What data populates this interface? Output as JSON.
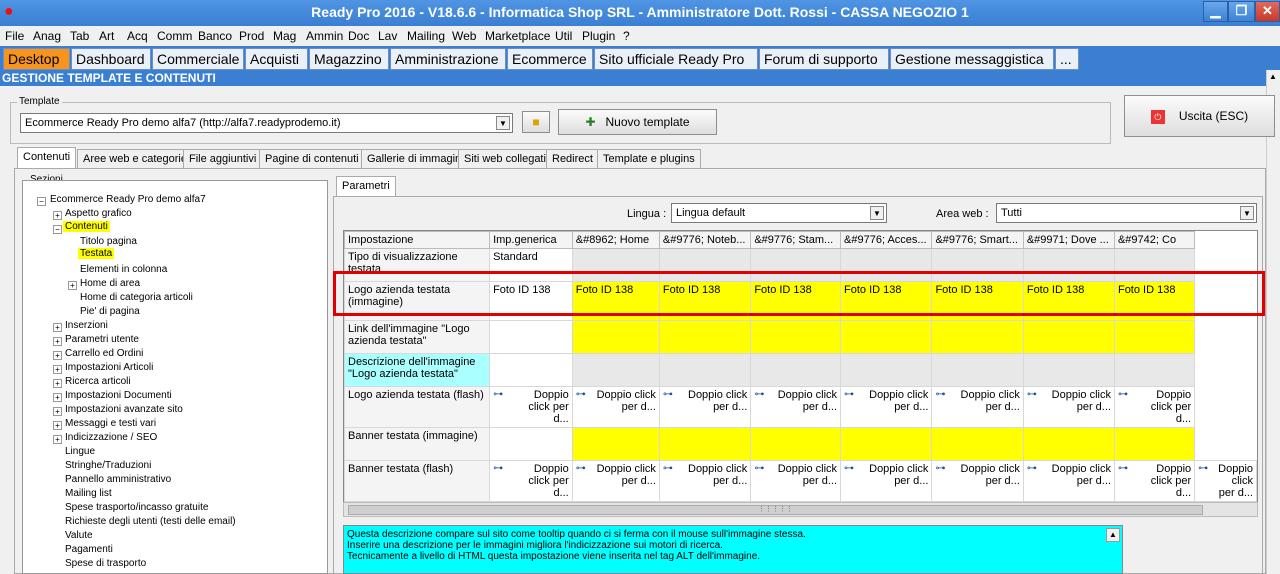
{
  "window": {
    "title": "Ready Pro 2016 - V18.6.6 - Informatica Shop SRL - Amministratore Dott. Rossi - CASSA NEGOZIO 1",
    "app_icon": "strawberry-icon"
  },
  "menu": [
    "File",
    "Anag",
    "Tab",
    "Art",
    "Acq",
    "Comm",
    "Banco",
    "Prod",
    "Mag",
    "Ammin",
    "Doc",
    "Lav",
    "Mailing",
    "Web",
    "Marketplace",
    "Util",
    "Plugin",
    "?"
  ],
  "main_tabs": [
    "Desktop",
    "Dashboard",
    "Commerciale",
    "Acquisti",
    "Magazzino",
    "Amministrazione",
    "Ecommerce",
    "Sito ufficiale Ready Pro",
    "Forum di supporto",
    "Gestione messaggistica",
    "..."
  ],
  "section_title": "GESTIONE TEMPLATE E CONTENUTI",
  "template": {
    "label": "Template",
    "value": "Ecommerce Ready Pro demo alfa7 (http://alfa7.readyprodemo.it)",
    "new_button": "Nuovo template",
    "exit_button": "Uscita (ESC)"
  },
  "sub_tabs": [
    "Contenuti",
    "Aree web e categorie",
    "File aggiuntivi",
    "Pagine di contenuti",
    "Gallerie di immagini",
    "Siti web collegati",
    "Redirect",
    "Template e plugins"
  ],
  "sections": {
    "label": "Sezioni",
    "root": "Ecommerce Ready Pro demo alfa7",
    "items": [
      "Aspetto grafico",
      "Contenuti",
      "Titolo pagina",
      "Testata",
      "Elementi in colonna",
      "Home di area",
      "Home di categoria articoli",
      "Pie' di pagina",
      "Inserzioni",
      "Parametri utente",
      "Carrello ed Ordini",
      "Impostazioni Articoli",
      "Ricerca articoli",
      "Impostazioni Documenti",
      "Impostazioni avanzate sito",
      "Messaggi e testi vari",
      "Indicizzazione / SEO",
      "Lingue",
      "Stringhe/Traduzioni",
      "Pannello amministrativo",
      "Mailing list",
      "Spese trasporto/incasso gratuite",
      "Richieste degli utenti (testi delle email)",
      "Valute",
      "Pagamenti",
      "Spese di trasporto"
    ]
  },
  "params": {
    "tab": "Parametri",
    "lingua_label": "Lingua :",
    "lingua_value": "Lingua default",
    "area_label": "Area web :",
    "area_value": "Tutti"
  },
  "grid": {
    "headers": [
      "Impostazione",
      "Imp.generica",
      "&#8962; Home",
      "&#9776; Noteb...",
      "&#9776; Stam...",
      "&#9776; Acces...",
      "&#9776; Smart...",
      "&#9971; Dove ...",
      "&#9742; Co"
    ],
    "rows": [
      {
        "name": "Tipo di visualizzazione testata",
        "generic": "Standard",
        "other": ""
      },
      {
        "name": "Logo azienda testata (immagine)",
        "generic": "Foto ID 138",
        "other": "Foto ID 138"
      },
      {
        "name": "Link dell'immagine \"Logo azienda testata\"",
        "generic": "",
        "other": ""
      },
      {
        "name": "Descrizione dell'immagine \"Logo azienda testata\"",
        "generic": "",
        "other": ""
      },
      {
        "name": "Logo azienda testata (flash)",
        "generic": "Doppio click per d...",
        "other": "Doppio click per d..."
      },
      {
        "name": "Banner testata (immagine)",
        "generic": "",
        "other": ""
      },
      {
        "name": "Banner testata (flash)",
        "generic": "Doppio click per d...",
        "other": "Doppio click per d..."
      }
    ]
  },
  "description": [
    "Questa descrizione compare sul sito come tooltip quando ci si ferma con il mouse sull'immagine stessa.",
    "Inserire una descrizione per le immagini migliora l'indicizzazione sui motori di ricerca.",
    "Tecnicamente a livello di HTML questa impostazione viene inserita nel tag ALT dell'immagine."
  ],
  "colors": {
    "highlight_yellow": "#ffff00",
    "cyan": "#00ffff",
    "active_tab": "#f7941d",
    "title_blue": "#3a7fd2",
    "red_outline": "#e00000"
  }
}
